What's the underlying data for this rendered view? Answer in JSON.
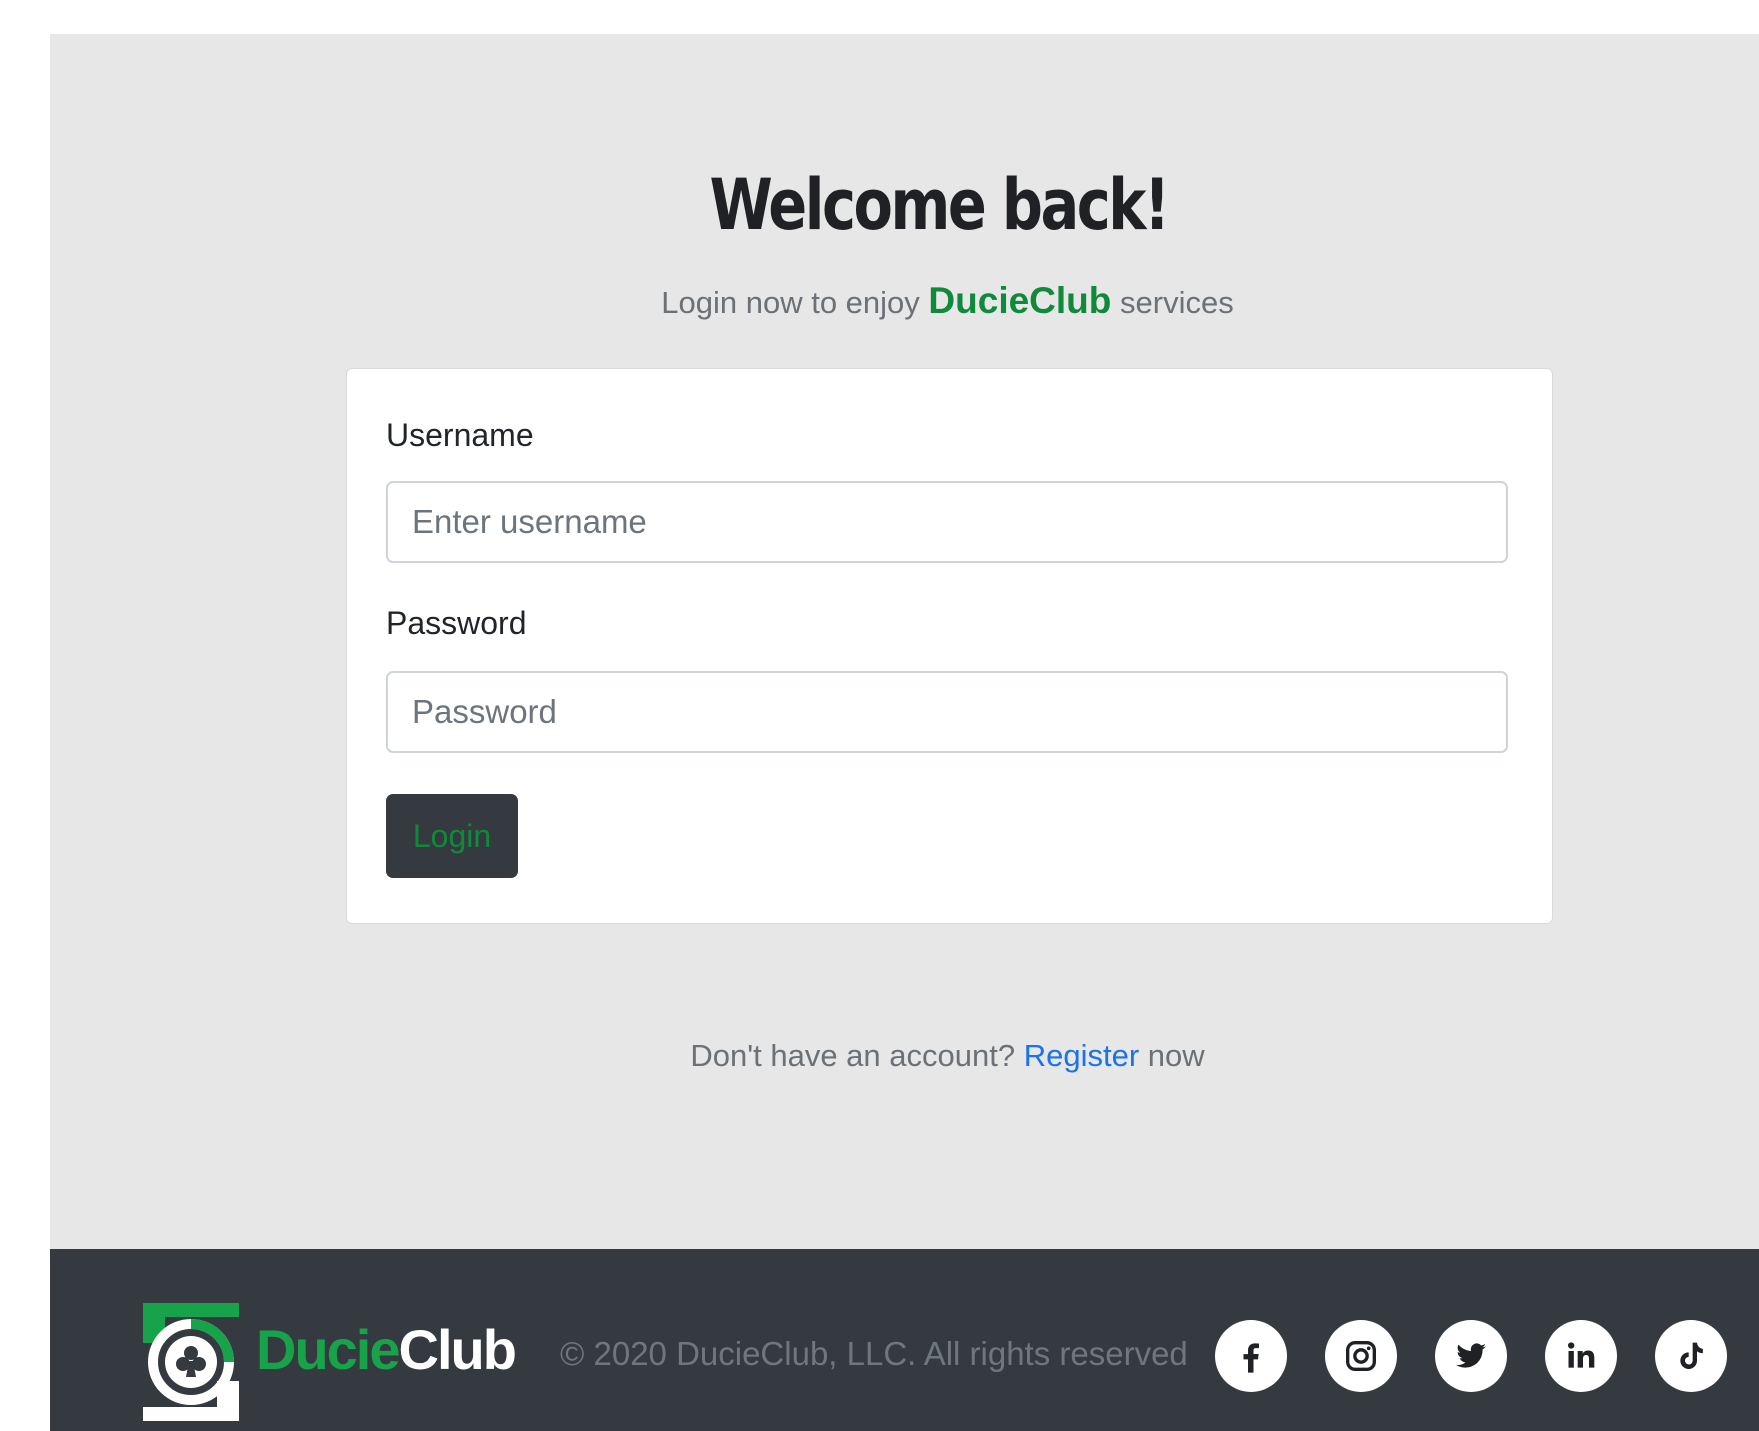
{
  "header": {
    "title": "Welcome back!",
    "subtitle_prefix": "Login now to enjoy",
    "subtitle_brand": "DucieClub",
    "subtitle_suffix": "services"
  },
  "form": {
    "username_label": "Username",
    "username_placeholder": "Enter username",
    "username_value": "",
    "password_label": "Password",
    "password_placeholder": "Password",
    "password_value": "",
    "login_button": "Login"
  },
  "register": {
    "prefix": "Don't have an account?",
    "link": "Register",
    "suffix": "now"
  },
  "footer": {
    "logo_part1": "Ducie",
    "logo_part2": "Club",
    "copyright": "© 2020 DucieClub, LLC. All rights reserved",
    "socials": [
      "facebook-icon",
      "instagram-icon",
      "twitter-icon",
      "linkedin-icon",
      "tiktok-icon"
    ]
  },
  "colors": {
    "brand_green": "#0f8a3a",
    "logo_green": "#17a34a",
    "dark": "#343a40",
    "link_blue": "#1a73e8",
    "page_bg": "#e6e7e6"
  }
}
